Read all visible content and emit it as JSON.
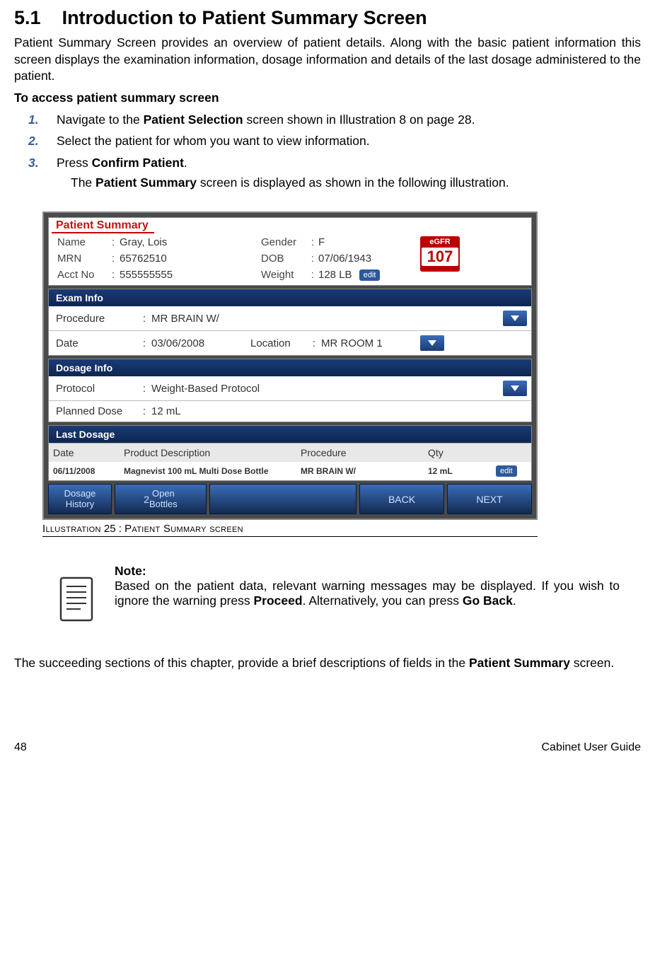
{
  "section_number": "5.1",
  "section_title": "Introduction to Patient Summary Screen",
  "intro": "Patient Summary Screen provides an overview of patient details. Along with the basic patient information this screen displays the examination information, dosage information and details of the last dosage administered to the patient.",
  "access_heading": "To access  patient summary screen",
  "steps": [
    {
      "num": "1.",
      "pre": "Navigate to the ",
      "bold": "Patient Selection",
      "post": " screen shown in Illustration 8 on page 28."
    },
    {
      "num": "2.",
      "pre": "Select the patient for whom you want to view information.",
      "bold": "",
      "post": ""
    },
    {
      "num": "3.",
      "pre": "Press ",
      "bold": "Confirm Patient",
      "post": "."
    }
  ],
  "step_sub_pre": "The ",
  "step_sub_bold": "Patient Summary",
  "step_sub_post": " screen is displayed as shown in the following illustration.",
  "screenshot": {
    "tab": "Patient Summary",
    "name_label": "Name",
    "name_value": "Gray, Lois",
    "mrn_label": "MRN",
    "mrn_value": "65762510",
    "acct_label": "Acct No",
    "acct_value": "555555555",
    "gender_label": "Gender",
    "gender_value": "F",
    "dob_label": "DOB",
    "dob_value": "07/06/1943",
    "weight_label": "Weight",
    "weight_value": "128 LB",
    "edit_label": "edit",
    "egfr_label": "eGFR",
    "egfr_value": "107",
    "exam_header": "Exam Info",
    "procedure_label": "Procedure",
    "procedure_value": "MR BRAIN W/",
    "date_label": "Date",
    "date_value": "03/06/2008",
    "location_label": "Location",
    "location_value": "MR ROOM 1",
    "dosage_header": "Dosage Info",
    "protocol_label": "Protocol",
    "protocol_value": "Weight-Based Protocol",
    "planned_label": "Planned Dose",
    "planned_value": "12 mL",
    "last_header": "Last Dosage",
    "tbl_headers": {
      "date": "Date",
      "prod": "Product Description",
      "proc": "Procedure",
      "qty": "Qty"
    },
    "tbl_row": {
      "date": "06/11/2008",
      "prod": "Magnevist 100 mL Multi Dose Bottle",
      "proc": "MR BRAIN W/",
      "qty": "12 mL"
    },
    "footer": {
      "history1": "Dosage",
      "history2": "History",
      "open_num": "2",
      "open1": "Open",
      "open2": "Bottles",
      "back": "BACK",
      "next": "NEXT"
    }
  },
  "caption_prefix": "Illustration",
  "caption_num": " 25 : ",
  "caption_rest": "Patient Summary screen",
  "note_label": "Note:",
  "note_body_pre": "Based on the patient data, relevant warning messages may be displayed. If you wish to ignore the warning press ",
  "note_bold1": "Proceed",
  "note_body_mid": ". Alternatively, you can press ",
  "note_bold2": "Go Back",
  "note_body_post": ".",
  "closing_pre": "The succeeding sections of this chapter, provide a brief descriptions of fields in the ",
  "closing_bold": "Patient Summary",
  "closing_post": "  screen.",
  "page_number": "48",
  "footer_right": "Cabinet User Guide"
}
